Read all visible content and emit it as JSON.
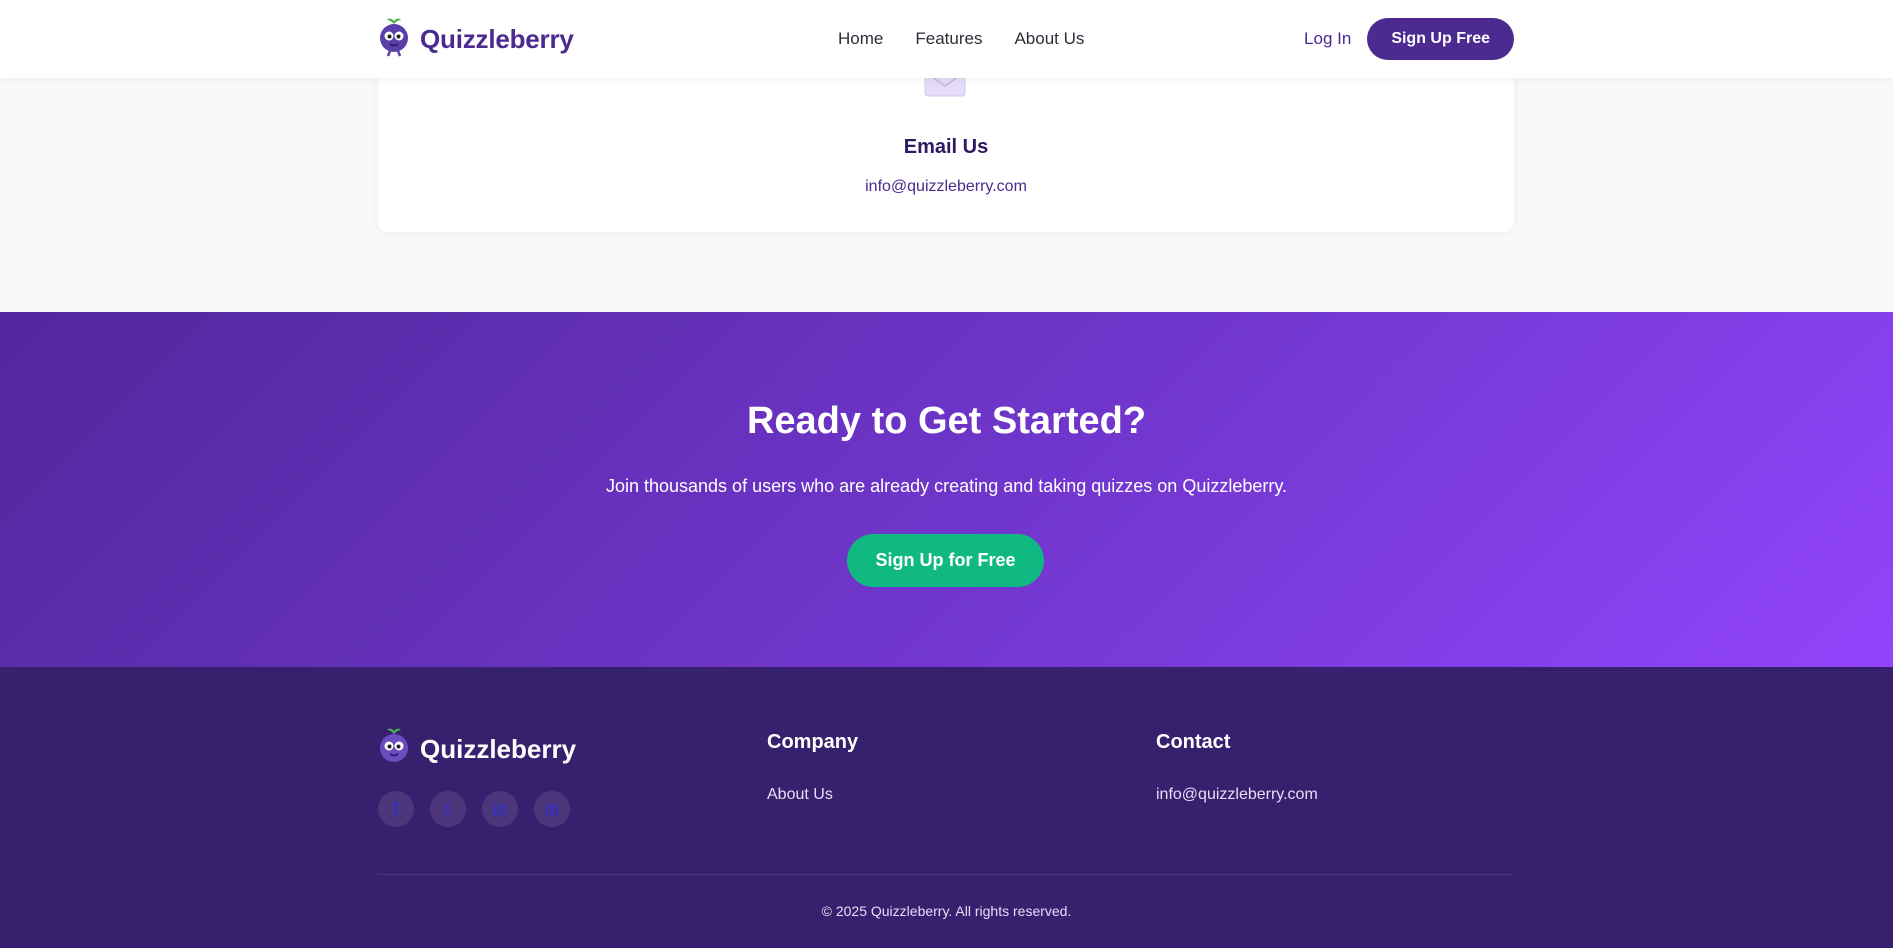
{
  "header": {
    "brand_name": "Quizzleberry",
    "logo_icon": "blueberry-mascot-icon",
    "nav": [
      {
        "label": "Home"
      },
      {
        "label": "Features"
      },
      {
        "label": "About Us"
      }
    ],
    "login_label": "Log In",
    "signup_label": "Sign Up Free"
  },
  "contact_card": {
    "icon": "envelope-icon",
    "title": "Email Us",
    "email": "info@quizzleberry.com"
  },
  "cta": {
    "title": "Ready to Get Started?",
    "subtitle": "Join thousands of users who are already creating and taking quizzes on Quizzleberry.",
    "button_label": "Sign Up for Free"
  },
  "footer": {
    "brand_name": "Quizzleberry",
    "socials": [
      "f",
      "t",
      "in",
      "ig"
    ],
    "company": {
      "title": "Company",
      "items": [
        "About Us"
      ]
    },
    "contact": {
      "title": "Contact",
      "items": [
        "info@quizzleberry.com"
      ]
    },
    "copyright": "© 2025 Quizzleberry. All rights reserved."
  },
  "colors": {
    "brand_purple": "#4c2a8f",
    "cta_gradient_start": "#52279c",
    "cta_gradient_end": "#9144fb",
    "cta_button_green": "#10b981",
    "footer_bg": "#37206d"
  }
}
